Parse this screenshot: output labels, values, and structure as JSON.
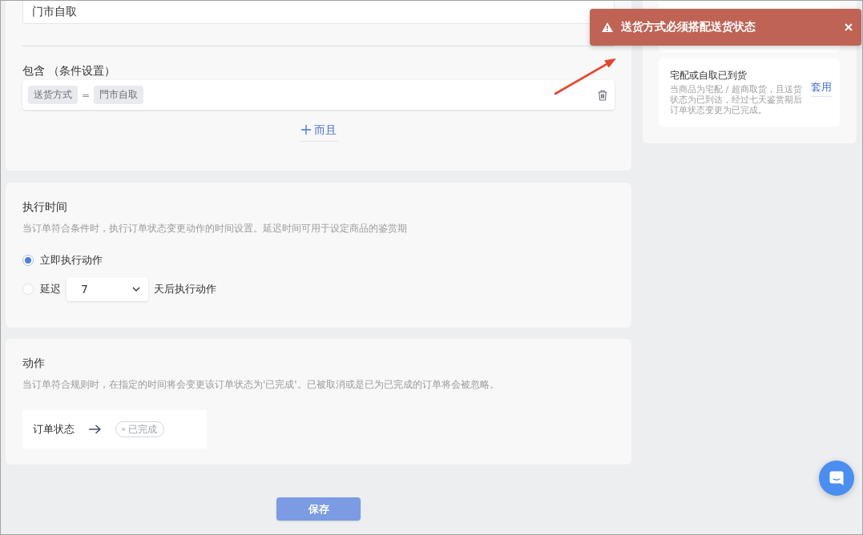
{
  "condition_section": {
    "pickup_field": {
      "value": "门市自取"
    },
    "include_label": "包含 （条件设置）",
    "conditions": [
      {
        "field": "送货方式",
        "operator": "=",
        "value": "門市自取"
      }
    ],
    "add_and_button": "而且"
  },
  "execution_time": {
    "title": "执行时间",
    "description": "当订单符合条件时，执行订单状态变更动作的时间设置。延迟时间可用于设定商品的鉴赏期",
    "options": [
      {
        "kind": "immediate",
        "label": "立即执行动作",
        "selected": true
      },
      {
        "kind": "delay",
        "label": "延迟",
        "selected": false,
        "select_value": "7",
        "suffix": "天后执行动作"
      }
    ]
  },
  "action": {
    "title": "动作",
    "description": "当订单符合规则时，在指定的时间将会变更该订单状态为'已完成'。已被取消或是已为已完成的订单将会被忽略。",
    "rule": {
      "label": "订单状态",
      "status": "已完成"
    }
  },
  "save_button": "保存",
  "templates": [
    {
      "title": "宅配或自取已到货",
      "description": "当商品为宅配 / 超商取货，且送货状态为已到达，经过七天鉴赏期后订单状态变更为已完成。",
      "apply_link": "套用"
    }
  ],
  "toast": {
    "kind": "error",
    "message": "送货方式必须搭配送货状态"
  }
}
